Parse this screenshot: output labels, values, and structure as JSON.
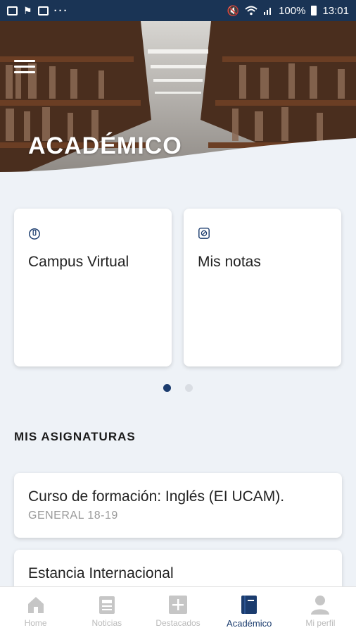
{
  "statusbar": {
    "battery": "100%",
    "time": "13:01",
    "more": "···"
  },
  "header": {
    "title": "ACADÉMICO"
  },
  "cards": [
    {
      "label": "Campus Virtual",
      "icon": "campus-icon"
    },
    {
      "label": "Mis notas",
      "icon": "grades-icon"
    }
  ],
  "carousel": {
    "active_page": 1,
    "page_count": 2
  },
  "section": {
    "title": "MIS ASIGNATURAS"
  },
  "subjects": [
    {
      "title": "Curso de formación: Inglés (EI UCAM).",
      "subtitle": "GENERAL 18-19"
    },
    {
      "title": "Estancia Internacional",
      "subtitle": ""
    }
  ],
  "nav": [
    {
      "label": "Home",
      "icon": "home-icon"
    },
    {
      "label": "Noticias",
      "icon": "news-icon"
    },
    {
      "label": "Destacados",
      "icon": "plus-icon"
    },
    {
      "label": "Académico",
      "icon": "book-icon",
      "active": true
    },
    {
      "label": "Mi perfil",
      "icon": "profile-icon"
    }
  ],
  "colors": {
    "primary": "#1b3c6e",
    "statusbar": "#1a3455",
    "inactive": "#bbbbbb",
    "background": "#eef2f7"
  }
}
